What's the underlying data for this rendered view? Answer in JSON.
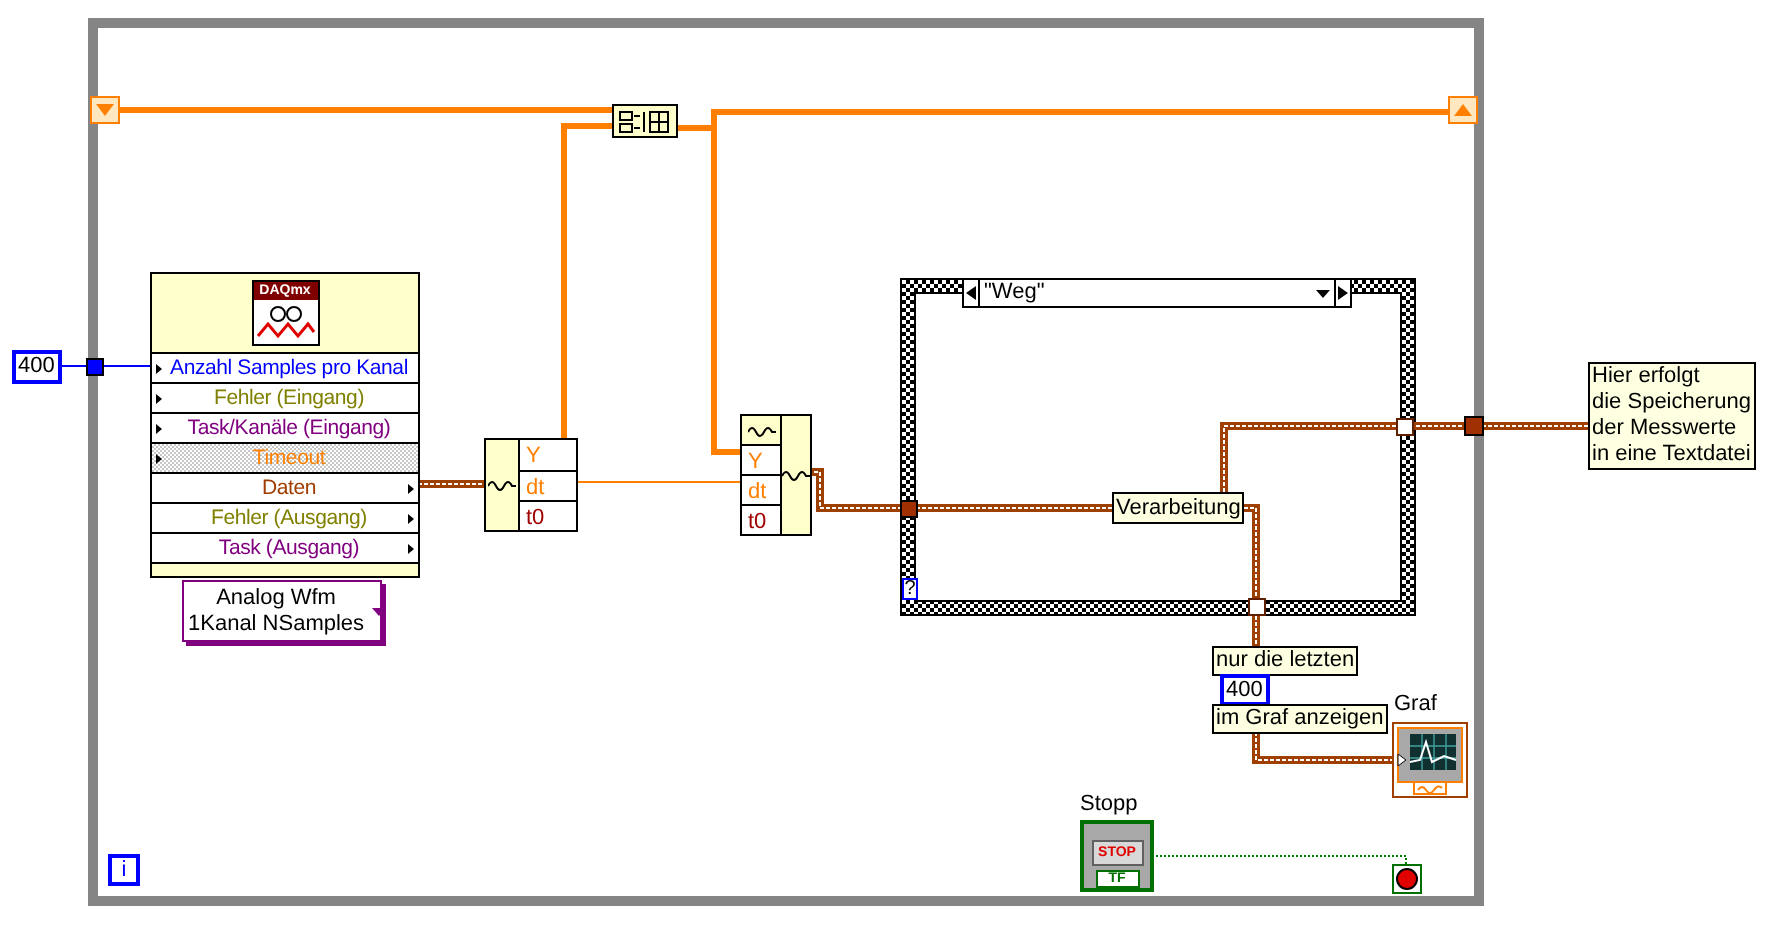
{
  "constant": "400",
  "daqmx_read": {
    "icon_label": "DAQmx",
    "terminals": [
      {
        "label": "Anzahl Samples pro Kanal",
        "kind": "input",
        "color": "#0000ff",
        "grayed": false
      },
      {
        "label": "Fehler (Eingang)",
        "kind": "input",
        "color": "#808000",
        "grayed": false
      },
      {
        "label": "Task/Kanäle (Eingang)",
        "kind": "input",
        "color": "#800080",
        "grayed": false
      },
      {
        "label": "Timeout",
        "kind": "input",
        "color": "#ff8000",
        "grayed": true
      },
      {
        "label": "Daten",
        "kind": "output",
        "color": "#a03c00",
        "grayed": false
      },
      {
        "label": "Fehler (Ausgang)",
        "kind": "output",
        "color": "#808000",
        "grayed": false
      },
      {
        "label": "Task (Ausgang)",
        "kind": "output",
        "color": "#800080",
        "grayed": false
      }
    ],
    "selector": [
      "Analog Wfm",
      "1Kanal NSamples"
    ]
  },
  "get_waveform": {
    "terminals": [
      {
        "label": "Y",
        "color": "#ff8000"
      },
      {
        "label": "dt",
        "color": "#ff8000"
      },
      {
        "label": "t0",
        "color": "#a00000"
      }
    ]
  },
  "build_waveform": {
    "terminals": [
      {
        "label": "Y",
        "color": "#ff8000"
      },
      {
        "label": "dt",
        "color": "#ff8000"
      },
      {
        "label": "t0",
        "color": "#a00000"
      }
    ]
  },
  "case_structure": {
    "selector": "\"Weg\"",
    "default_terminal": "?",
    "label": "Verarbeitung"
  },
  "save_note": [
    "Hier erfolgt",
    "die Speicherung",
    "der Messwerte",
    "in eine Textdatei"
  ],
  "graph_hint": {
    "before": "nur die letzten",
    "count": "400",
    "after": "im Graf anzeigen"
  },
  "graph": {
    "label": "Graf"
  },
  "stop_button": {
    "label": "Stopp",
    "caption": "STOP",
    "type_label": "TF"
  },
  "iteration_terminal": "i"
}
